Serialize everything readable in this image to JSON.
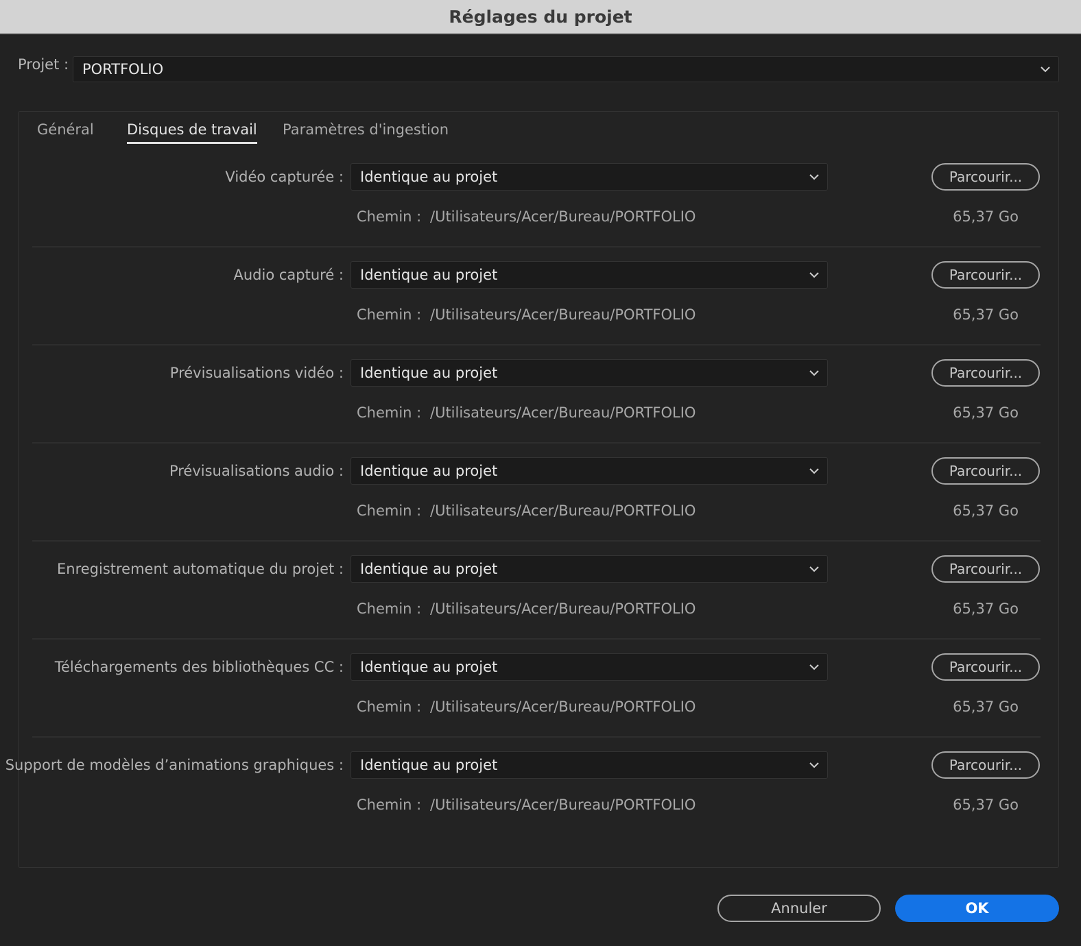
{
  "window": {
    "title": "Réglages du projet"
  },
  "project": {
    "label": "Projet :",
    "value": "PORTFOLIO"
  },
  "tabs": [
    {
      "label": "Général",
      "active": false
    },
    {
      "label": "Disques de travail",
      "active": true
    },
    {
      "label": "Paramètres d'ingestion",
      "active": false
    }
  ],
  "sections": [
    {
      "label": "Vidéo capturée :",
      "value": "Identique au projet",
      "browse": "Parcourir...",
      "path_label": "Chemin :",
      "path": "/Utilisateurs/Acer/Bureau/PORTFOLIO",
      "size": "65,37 Go"
    },
    {
      "label": "Audio capturé :",
      "value": "Identique au projet",
      "browse": "Parcourir...",
      "path_label": "Chemin :",
      "path": "/Utilisateurs/Acer/Bureau/PORTFOLIO",
      "size": "65,37 Go"
    },
    {
      "label": "Prévisualisations vidéo :",
      "value": "Identique au projet",
      "browse": "Parcourir...",
      "path_label": "Chemin :",
      "path": "/Utilisateurs/Acer/Bureau/PORTFOLIO",
      "size": "65,37 Go"
    },
    {
      "label": "Prévisualisations audio :",
      "value": "Identique au projet",
      "browse": "Parcourir...",
      "path_label": "Chemin :",
      "path": "/Utilisateurs/Acer/Bureau/PORTFOLIO",
      "size": "65,37 Go"
    },
    {
      "label": "Enregistrement automatique du projet :",
      "value": "Identique au projet",
      "browse": "Parcourir...",
      "path_label": "Chemin :",
      "path": "/Utilisateurs/Acer/Bureau/PORTFOLIO",
      "size": "65,37 Go"
    },
    {
      "label": "Téléchargements des bibliothèques CC :",
      "value": "Identique au projet",
      "browse": "Parcourir...",
      "path_label": "Chemin :",
      "path": "/Utilisateurs/Acer/Bureau/PORTFOLIO",
      "size": "65,37 Go"
    },
    {
      "label": "Support de modèles d’animations graphiques :",
      "value": "Identique au projet",
      "browse": "Parcourir...",
      "path_label": "Chemin :",
      "path": "/Utilisateurs/Acer/Bureau/PORTFOLIO",
      "size": "65,37 Go"
    }
  ],
  "footer": {
    "cancel_label": "Annuler",
    "ok_label": "OK"
  },
  "colors": {
    "accent": "#1473e6",
    "background": "#222222",
    "titlebar": "#d3d3d3"
  }
}
